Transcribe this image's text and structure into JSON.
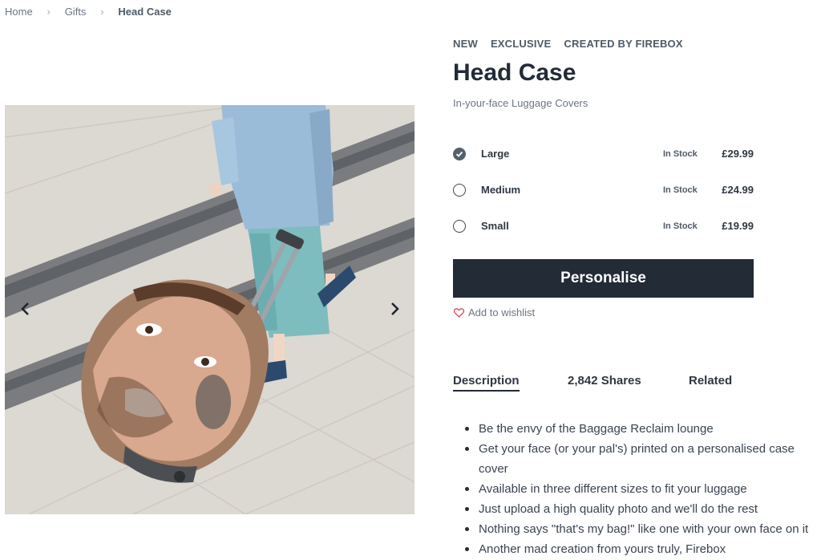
{
  "breadcrumb": {
    "items": [
      {
        "label": "Home"
      },
      {
        "label": "Gifts"
      },
      {
        "label": "Head Case"
      }
    ],
    "separator": "›"
  },
  "product": {
    "badges": [
      "NEW",
      "EXCLUSIVE",
      "CREATED BY FIREBOX"
    ],
    "title": "Head Case",
    "subtitle": "In-your-face Luggage Covers",
    "options": [
      {
        "label": "Large",
        "stock": "In Stock",
        "price": "£29.99",
        "selected": true
      },
      {
        "label": "Medium",
        "stock": "In Stock",
        "price": "£24.99",
        "selected": false
      },
      {
        "label": "Small",
        "stock": "In Stock",
        "price": "£19.99",
        "selected": false
      }
    ],
    "cta_label": "Personalise",
    "wishlist_label": "Add to wishlist"
  },
  "tabs": [
    {
      "label": "Description",
      "active": true
    },
    {
      "label": "2,842 Shares",
      "active": false
    },
    {
      "label": "Related",
      "active": false
    }
  ],
  "description": {
    "bullets": [
      "Be the envy of the Baggage Reclaim lounge",
      "Get your face (or your pal's) printed on a personalised case cover",
      "Available in three different sizes to fit your luggage",
      "Just upload a high quality photo and we'll do the rest",
      "Nothing says \"that's my bag!\" like one with your own face on it",
      "Another mad creation from yours truly, Firebox"
    ]
  },
  "icons": {
    "gallery_prev": "chevron-left-icon",
    "gallery_next": "chevron-right-icon",
    "option_selected": "check-icon",
    "wishlist": "heart-icon"
  },
  "colors": {
    "primary": "#222b36",
    "muted_text": "#6b7580",
    "wishlist_heart": "#d9485f"
  }
}
